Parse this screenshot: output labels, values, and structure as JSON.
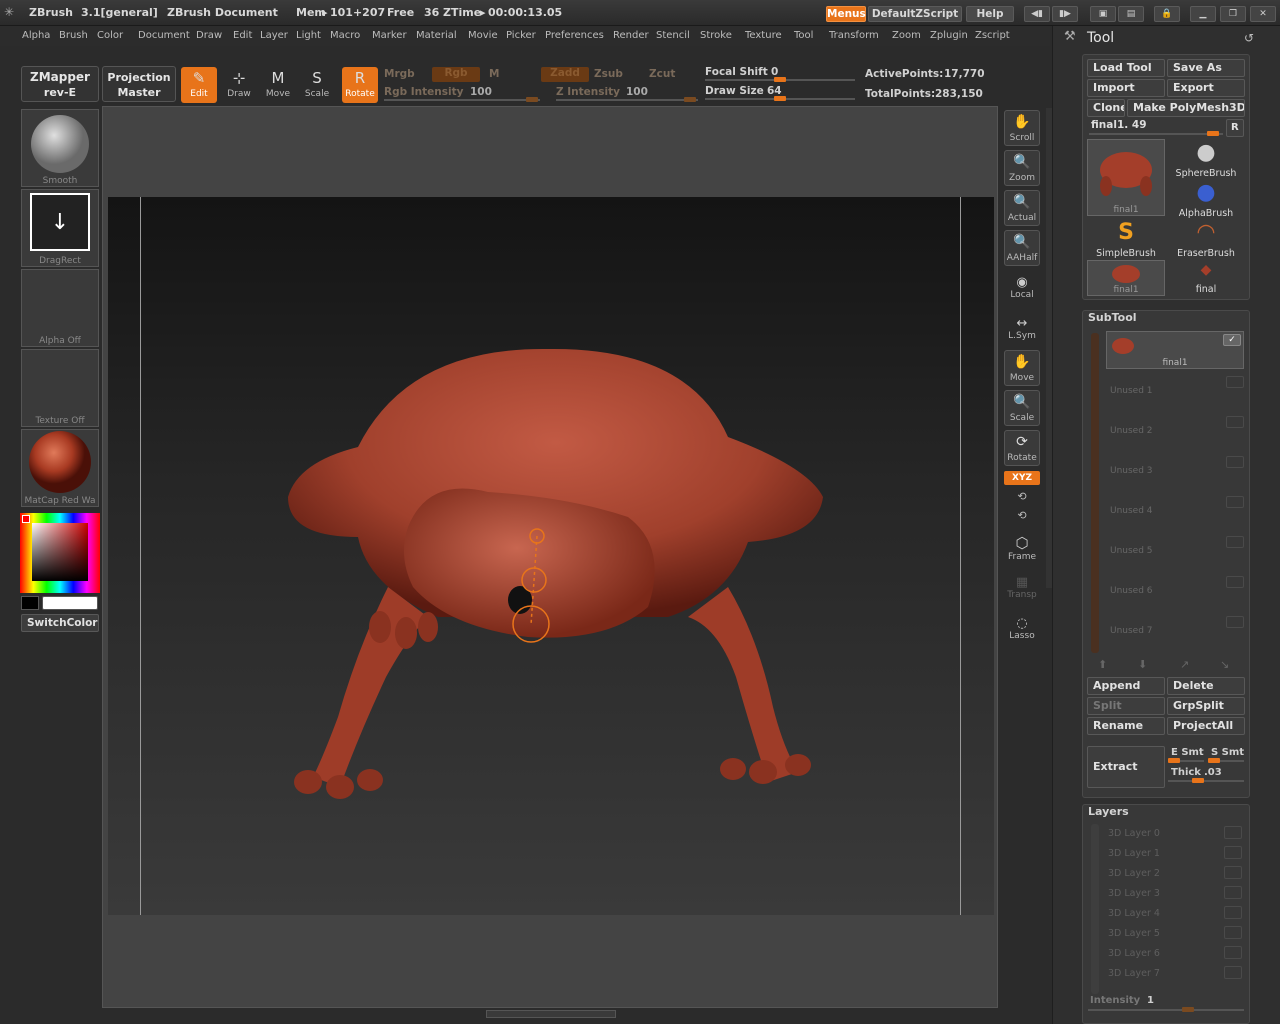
{
  "app": {
    "name": "ZBrush",
    "version": "3.1[general]",
    "document": "ZBrush Document",
    "mem_label": "Mem",
    "mem_value": "101+207",
    "free_label": "Free",
    "free_value": "36",
    "ztime_label": "ZTime",
    "ztime_value": "00:00:13.05",
    "menus_button": "Menus",
    "script_button": "DefaultZScript",
    "help_button": "Help"
  },
  "menubar": [
    "Alpha",
    "Brush",
    "Color",
    "Document",
    "Draw",
    "Edit",
    "Layer",
    "Light",
    "Macro",
    "Marker",
    "Material",
    "Movie",
    "Picker",
    "Preferences",
    "Render",
    "Stencil",
    "Stroke",
    "Texture",
    "Tool",
    "Transform",
    "Zoom",
    "Zplugin",
    "Zscript"
  ],
  "toolbar": {
    "zmapper_line1": "ZMapper",
    "zmapper_line2": "rev-E",
    "projection_line1": "Projection",
    "projection_line2": "Master",
    "modes": [
      {
        "label": "Edit",
        "glyph": "✎",
        "active": true
      },
      {
        "label": "Draw",
        "glyph": "⊹",
        "active": false
      },
      {
        "label": "Move",
        "glyph": "M",
        "active": false
      },
      {
        "label": "Scale",
        "glyph": "S",
        "active": false
      },
      {
        "label": "Rotate",
        "glyph": "R",
        "active": true
      }
    ],
    "mrgb": "Mrgb",
    "rgb": "Rgb",
    "m": "M",
    "zadd": "Zadd",
    "zsub": "Zsub",
    "zcut": "Zcut",
    "rgb_intensity_label": "Rgb Intensity",
    "rgb_intensity_value": "100",
    "z_intensity_label": "Z Intensity",
    "z_intensity_value": "100",
    "focal_shift_label": "Focal Shift",
    "focal_shift_value": "0",
    "draw_size_label": "Draw Size",
    "draw_size_value": "64",
    "active_points_label": "ActivePoints:",
    "active_points_value": "17,770",
    "total_points_label": "TotalPoints:",
    "total_points_value": "283,150"
  },
  "left_shelf": {
    "brush": "Smooth",
    "stroke": "DragRect",
    "alpha": "Alpha Off",
    "texture": "Texture Off",
    "material": "MatCap Red Wa",
    "switch_color": "SwitchColor",
    "colors": {
      "primary": "#000000",
      "secondary": "#ffffff",
      "material": "#b0402c"
    }
  },
  "right_shelf": [
    {
      "label": "Scroll",
      "glyph": "✋"
    },
    {
      "label": "Zoom",
      "glyph": "🔍"
    },
    {
      "label": "Actual",
      "glyph": "🔍"
    },
    {
      "label": "AAHalf",
      "glyph": "🔍"
    },
    {
      "label": "Local",
      "glyph": "◉"
    },
    {
      "label": "L.Sym",
      "glyph": "↔"
    },
    {
      "label": "Move",
      "glyph": "✋"
    },
    {
      "label": "Scale",
      "glyph": "🔍"
    },
    {
      "label": "Rotate",
      "glyph": "⟳"
    },
    {
      "label": "Frame",
      "glyph": "⬡"
    },
    {
      "label": "Transp",
      "glyph": "▦"
    },
    {
      "label": "Lasso",
      "glyph": "◌"
    }
  ],
  "xyz_button": "XYZ",
  "tool_panel": {
    "title": "Tool",
    "load_tool": "Load Tool",
    "save_as": "Save As",
    "import": "Import",
    "export": "Export",
    "clone": "Clone",
    "make_polymesh": "Make PolyMesh3D",
    "current_tool": "final1. 49",
    "r_button": "R",
    "tools": [
      "final1",
      "SphereBrush",
      "AlphaBrush",
      "SimpleBrush",
      "EraserBrush",
      "final1",
      "final"
    ]
  },
  "subtool": {
    "title": "SubTool",
    "active": "final1",
    "unused": [
      "Unused 1",
      "Unused 2",
      "Unused 3",
      "Unused 4",
      "Unused 5",
      "Unused 6",
      "Unused 7"
    ],
    "append": "Append",
    "delete": "Delete",
    "split": "Split",
    "grpsplit": "GrpSplit",
    "rename": "Rename",
    "projectall": "ProjectAll",
    "extract": "Extract",
    "e_smt": "E Smt",
    "s_smt": "S Smt",
    "thick_label": "Thick",
    "thick_value": ".03"
  },
  "layers": {
    "title": "Layers",
    "items": [
      "3D Layer 0",
      "3D Layer 1",
      "3D Layer 2",
      "3D Layer 3",
      "3D Layer 4",
      "3D Layer 5",
      "3D Layer 6",
      "3D Layer 7"
    ],
    "intensity_label": "Intensity",
    "intensity_value": "1"
  },
  "accent_color": "#e8741a",
  "model_color": "#b0402c"
}
